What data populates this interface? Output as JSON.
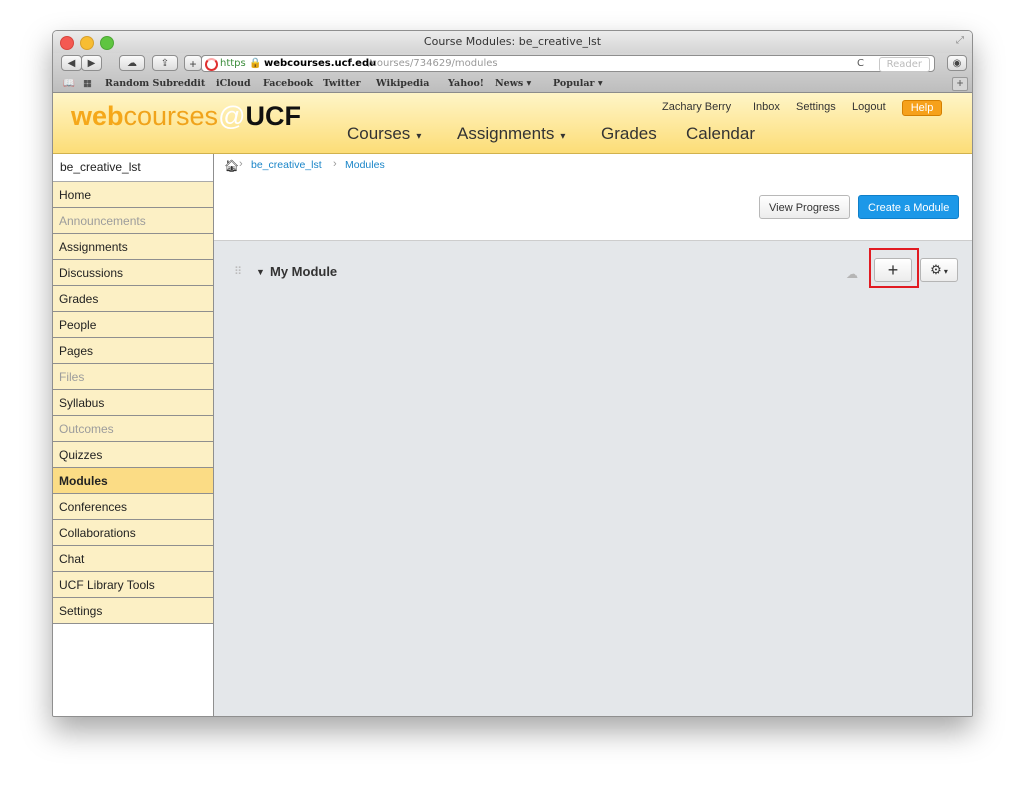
{
  "window": {
    "title": "Course Modules: be_creative_lst"
  },
  "toolbar": {
    "back": "◀",
    "forward": "▶",
    "add": "+",
    "url_scheme": "https",
    "url_host": "webcourses.ucf.edu",
    "url_path": "/courses/734629/modules",
    "reload": "C",
    "reader": "Reader"
  },
  "bookmarks": [
    "Random Subreddit",
    "iCloud",
    "Facebook",
    "Twitter",
    "Wikipedia",
    "Yahoo!",
    "News ▾",
    "Popular ▾"
  ],
  "header": {
    "logo": {
      "web": "web",
      "courses": "courses",
      "at": "@",
      "ucf": "UCF"
    },
    "user_links": [
      "Zachary Berry",
      "Inbox",
      "Settings",
      "Logout"
    ],
    "help": "Help",
    "nav": [
      "Courses",
      "Assignments",
      "Grades",
      "Calendar"
    ],
    "dropdown_caret": "▾"
  },
  "sidebar": {
    "course_title": "be_creative_lst",
    "items": [
      {
        "label": "Home",
        "state": "normal"
      },
      {
        "label": "Announcements",
        "state": "disabled"
      },
      {
        "label": "Assignments",
        "state": "normal"
      },
      {
        "label": "Discussions",
        "state": "normal"
      },
      {
        "label": "Grades",
        "state": "normal"
      },
      {
        "label": "People",
        "state": "normal"
      },
      {
        "label": "Pages",
        "state": "normal"
      },
      {
        "label": "Files",
        "state": "disabled"
      },
      {
        "label": "Syllabus",
        "state": "normal"
      },
      {
        "label": "Outcomes",
        "state": "disabled"
      },
      {
        "label": "Quizzes",
        "state": "normal"
      },
      {
        "label": "Modules",
        "state": "active"
      },
      {
        "label": "Conferences",
        "state": "normal"
      },
      {
        "label": "Collaborations",
        "state": "normal"
      },
      {
        "label": "Chat",
        "state": "normal"
      },
      {
        "label": "UCF Library Tools",
        "state": "normal"
      },
      {
        "label": "Settings",
        "state": "normal"
      }
    ]
  },
  "breadcrumb": {
    "items": [
      "be_creative_lst",
      "Modules"
    ],
    "separator": "›"
  },
  "actions": {
    "view_progress": "View Progress",
    "create_module": "Create a Module"
  },
  "module": {
    "title": "My Module",
    "add_label": "+",
    "gear_label": "⚙",
    "gear_caret": "▾"
  },
  "colors": {
    "accent": "#1c98e8",
    "header": "#fcdd77",
    "sidebar": "#fcf0c5",
    "active": "#fbdc85",
    "help": "#f6a11b",
    "highlight": "#e11b22"
  }
}
